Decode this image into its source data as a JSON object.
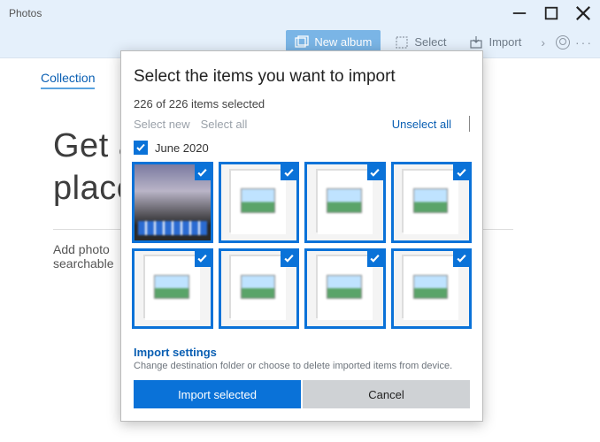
{
  "titlebar": {
    "title": "Photos"
  },
  "toolbar": {
    "new_album": "New album",
    "select": "Select",
    "import": "Import"
  },
  "subnav": {
    "collection": "Collection"
  },
  "background": {
    "heading_line1": "Get a",
    "heading_line2": "place",
    "subtext_part1": "Add photo",
    "subtext_part2": "searchable"
  },
  "dialog": {
    "title": "Select the items you want to import",
    "count_text": "226 of 226 items selected",
    "select_new": "Select new",
    "select_all": "Select all",
    "unselect_all": "Unselect all",
    "group_label": "June 2020",
    "import_settings_label": "Import settings",
    "import_settings_desc": "Change destination folder or choose to delete imported items from device.",
    "import_button": "Import selected",
    "cancel_button": "Cancel"
  }
}
